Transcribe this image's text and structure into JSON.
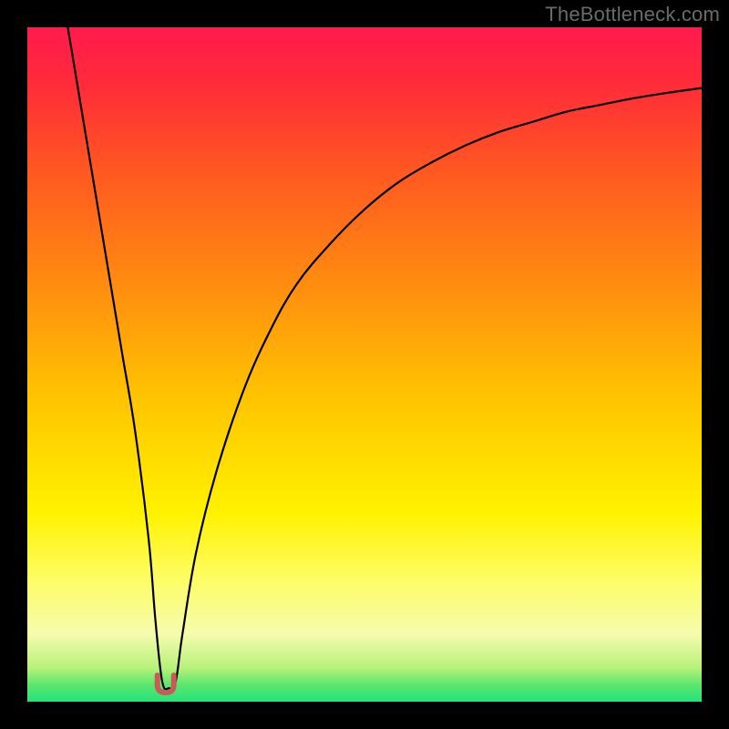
{
  "watermark": "TheBottleneck.com",
  "colors": {
    "frame": "#000000",
    "curve": "#000000",
    "marker_fill": "#c85a57",
    "marker_stroke": "#9e3d3a",
    "gradient_stops": [
      {
        "offset": 0.0,
        "color": "#ff1b4d"
      },
      {
        "offset": 0.08,
        "color": "#ff2a3a"
      },
      {
        "offset": 0.22,
        "color": "#ff5a20"
      },
      {
        "offset": 0.38,
        "color": "#ff8c10"
      },
      {
        "offset": 0.55,
        "color": "#ffc400"
      },
      {
        "offset": 0.72,
        "color": "#fff200"
      },
      {
        "offset": 0.82,
        "color": "#fdfd66"
      },
      {
        "offset": 0.9,
        "color": "#f6fbae"
      },
      {
        "offset": 0.95,
        "color": "#b6f27a"
      },
      {
        "offset": 0.975,
        "color": "#5ce66e"
      },
      {
        "offset": 1.0,
        "color": "#24e37a"
      }
    ]
  },
  "chart_data": {
    "type": "line",
    "title": "",
    "xlabel": "",
    "ylabel": "",
    "xlim": [
      0,
      100
    ],
    "ylim": [
      0,
      100
    ],
    "grid": false,
    "legend": false,
    "series": [
      {
        "name": "bottleneck-curve",
        "x": [
          6,
          8,
          10,
          12,
          14,
          16,
          18,
          19,
          20,
          21,
          22,
          23,
          25,
          28,
          32,
          36,
          40,
          45,
          50,
          55,
          60,
          65,
          70,
          75,
          80,
          85,
          90,
          95,
          100
        ],
        "y": [
          100,
          88,
          76,
          64,
          52,
          40,
          24,
          12,
          3,
          2,
          3,
          10,
          22,
          34,
          46,
          55,
          62,
          68,
          73,
          77,
          80,
          82.5,
          84.5,
          86,
          87.5,
          88.5,
          89.5,
          90.3,
          91
        ]
      }
    ],
    "annotations": [
      {
        "name": "minimum-marker",
        "x": 20.5,
        "y": 2.2,
        "shape": "u"
      }
    ]
  }
}
